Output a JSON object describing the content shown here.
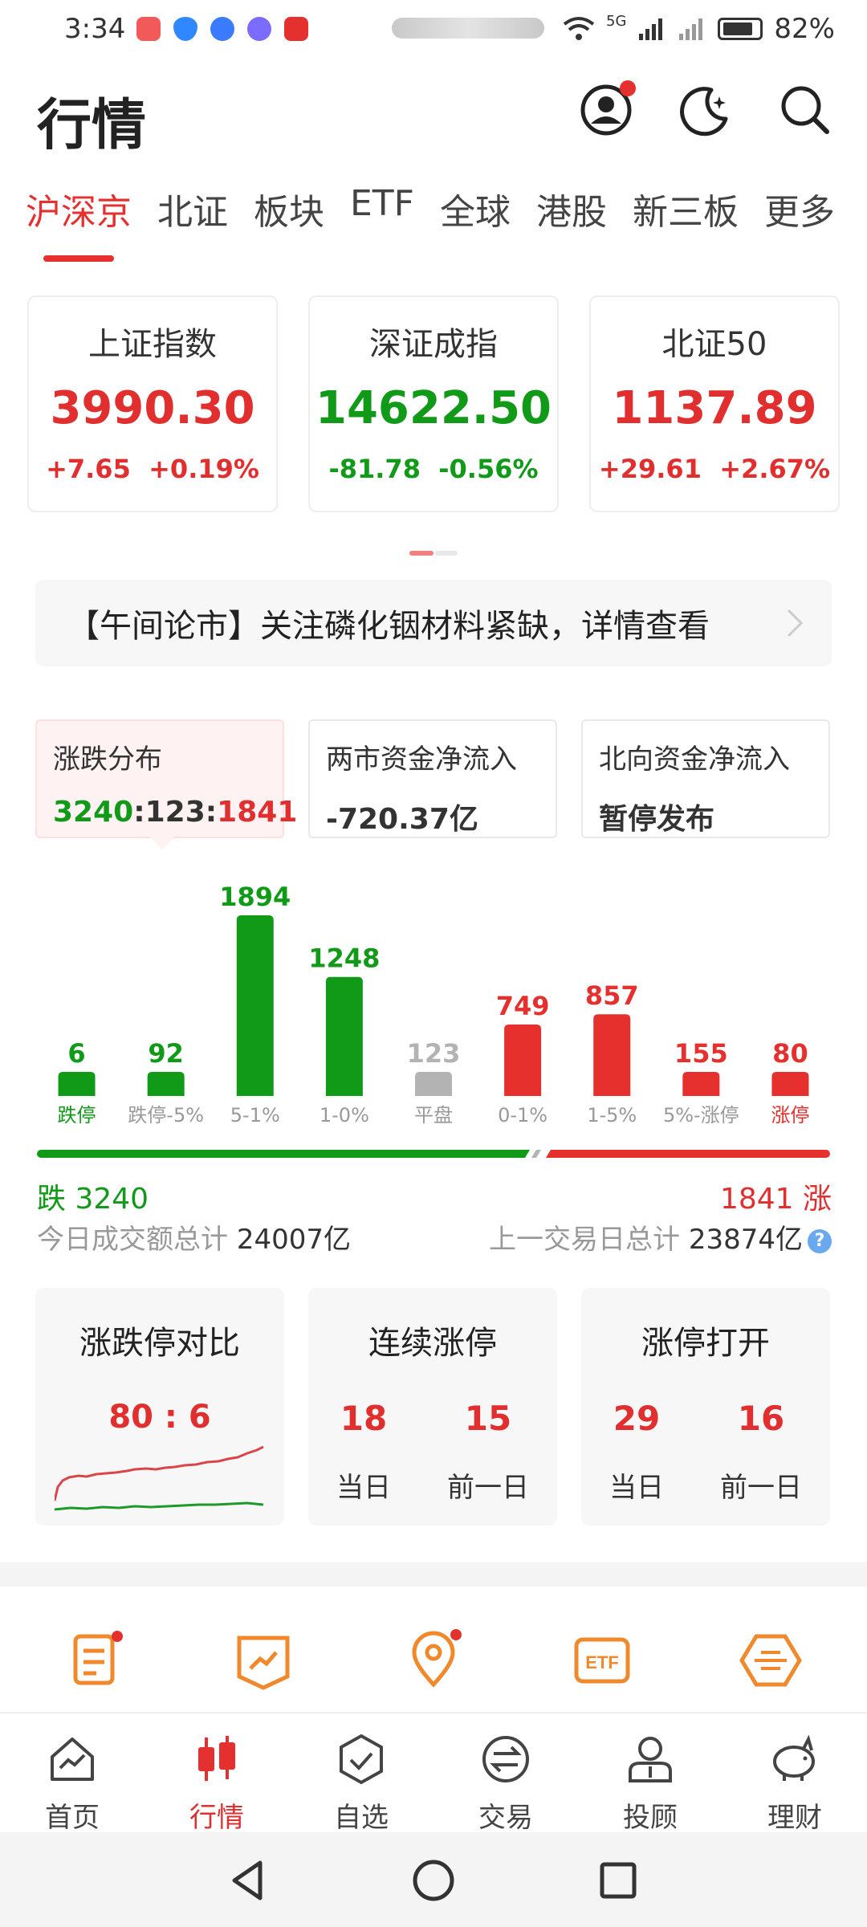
{
  "status_bar": {
    "time": "3:34",
    "network_label": "5G",
    "battery": "82%"
  },
  "header": {
    "title": "行情"
  },
  "tabs": [
    {
      "label": "沪深京",
      "active": true
    },
    {
      "label": "北证"
    },
    {
      "label": "板块"
    },
    {
      "label": "ETF"
    },
    {
      "label": "全球"
    },
    {
      "label": "港股"
    },
    {
      "label": "新三板"
    },
    {
      "label": "更多"
    }
  ],
  "indices": [
    {
      "name": "上证指数",
      "value": "3990.30",
      "change": "+7.65",
      "pct": "+0.19%",
      "color": "red"
    },
    {
      "name": "深证成指",
      "value": "14622.50",
      "change": "-81.78",
      "pct": "-0.56%",
      "color": "green"
    },
    {
      "name": "北证50",
      "value": "1137.89",
      "change": "+29.61",
      "pct": "+2.67%",
      "color": "red"
    }
  ],
  "news": {
    "text": "【午间论市】关注磷化铟材料紧缺，详情查看"
  },
  "stats": {
    "distribution_label": "涨跌分布",
    "distribution_down": "3240",
    "distribution_flat": "123",
    "distribution_up": "1841",
    "inflow_label": "两市资金净流入",
    "inflow_value": "-720.37亿",
    "north_label": "北向资金净流入",
    "north_value": "暂停发布"
  },
  "chart_data": {
    "type": "bar",
    "categories": [
      "跌停",
      "跌停-5%",
      "5-1%",
      "1-0%",
      "平盘",
      "0-1%",
      "1-5%",
      "5%-涨停",
      "涨停"
    ],
    "values": [
      6,
      92,
      1894,
      1248,
      123,
      749,
      857,
      155,
      80
    ],
    "colors": [
      "#119a18",
      "#119a18",
      "#119a18",
      "#119a18",
      "#b3b3b3",
      "#e5302e",
      "#e5302e",
      "#e5302e",
      "#e5302e"
    ],
    "label_colors": [
      "#119a18",
      "#999999",
      "#999999",
      "#999999",
      "#999999",
      "#999999",
      "#999999",
      "#999999",
      "#e02f2e"
    ],
    "down_total": 3240,
    "up_total": 1841
  },
  "summary": {
    "down_label": "跌 3240",
    "up_label": "1841 涨",
    "today_label": "今日成交额总计",
    "today_value": "24007亿",
    "prev_label": "上一交易日总计",
    "prev_value": "23874亿"
  },
  "limit_cards": {
    "compare_title": "涨跌停对比",
    "compare_ratio": "80 : 6",
    "consec_title": "连续涨停",
    "consec_today": "18",
    "consec_prev": "15",
    "open_title": "涨停打开",
    "open_today": "29",
    "open_prev": "16",
    "today_label": "当日",
    "prev_label": "前一日"
  },
  "bottom_nav": [
    {
      "label": "首页"
    },
    {
      "label": "行情",
      "active": true
    },
    {
      "label": "自选"
    },
    {
      "label": "交易"
    },
    {
      "label": "投顾"
    },
    {
      "label": "理财"
    }
  ]
}
